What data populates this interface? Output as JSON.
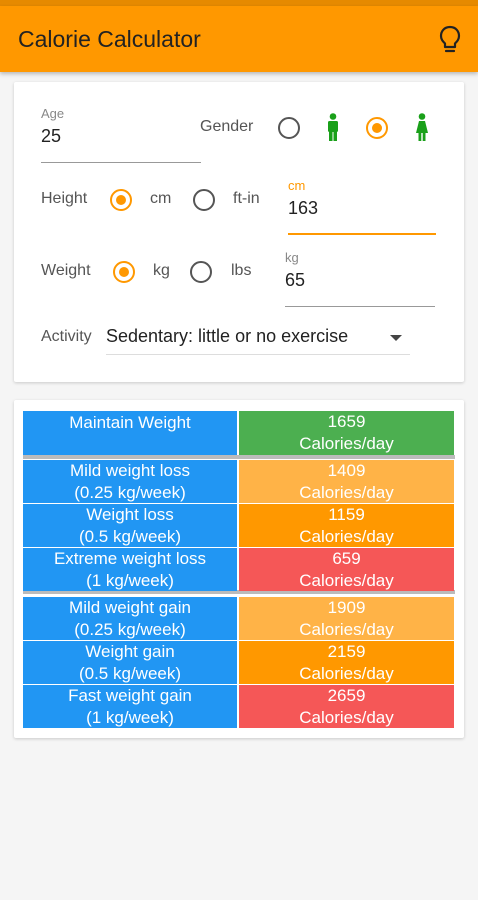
{
  "app": {
    "title": "Calorie Calculator",
    "icon": "lightbulb-icon"
  },
  "form": {
    "age": {
      "label": "Age",
      "value": "25"
    },
    "gender": {
      "label": "Gender",
      "selected": "female",
      "options": [
        "male-icon",
        "female-icon"
      ]
    },
    "height": {
      "label": "Height",
      "opt_cm": "cm",
      "opt_ftin": "ft-in",
      "selected": "cm",
      "unit_label": "cm",
      "value": "163"
    },
    "weight": {
      "label": "Weight",
      "opt_kg": "kg",
      "opt_lbs": "lbs",
      "selected": "kg",
      "unit_label": "kg",
      "value": "65"
    },
    "activity": {
      "label": "Activity",
      "value": "Sedentary: little or no exercise"
    }
  },
  "results": [
    {
      "name": "Maintain Weight",
      "rate": "",
      "calories": "1659",
      "unit": "Calories/day",
      "color": "#4caf50"
    },
    {
      "name": "Mild weight loss",
      "rate": "(0.25 kg/week)",
      "calories": "1409",
      "unit": "Calories/day",
      "color": "#ffb347"
    },
    {
      "name": "Weight loss",
      "rate": "(0.5 kg/week)",
      "calories": "1159",
      "unit": "Calories/day",
      "color": "#ff9800"
    },
    {
      "name": "Extreme weight loss",
      "rate": "(1 kg/week)",
      "calories": "659",
      "unit": "Calories/day",
      "color": "#f55757"
    },
    {
      "name": "Mild weight gain",
      "rate": "(0.25 kg/week)",
      "calories": "1909",
      "unit": "Calories/day",
      "color": "#ffb347"
    },
    {
      "name": "Weight gain",
      "rate": "(0.5 kg/week)",
      "calories": "2159",
      "unit": "Calories/day",
      "color": "#ff9800"
    },
    {
      "name": "Fast weight gain",
      "rate": "(1 kg/week)",
      "calories": "2659",
      "unit": "Calories/day",
      "color": "#f55757"
    }
  ],
  "colors": {
    "accent": "#ff9800",
    "table_left": "#2196f3",
    "person_icon": "#1aa01a"
  }
}
